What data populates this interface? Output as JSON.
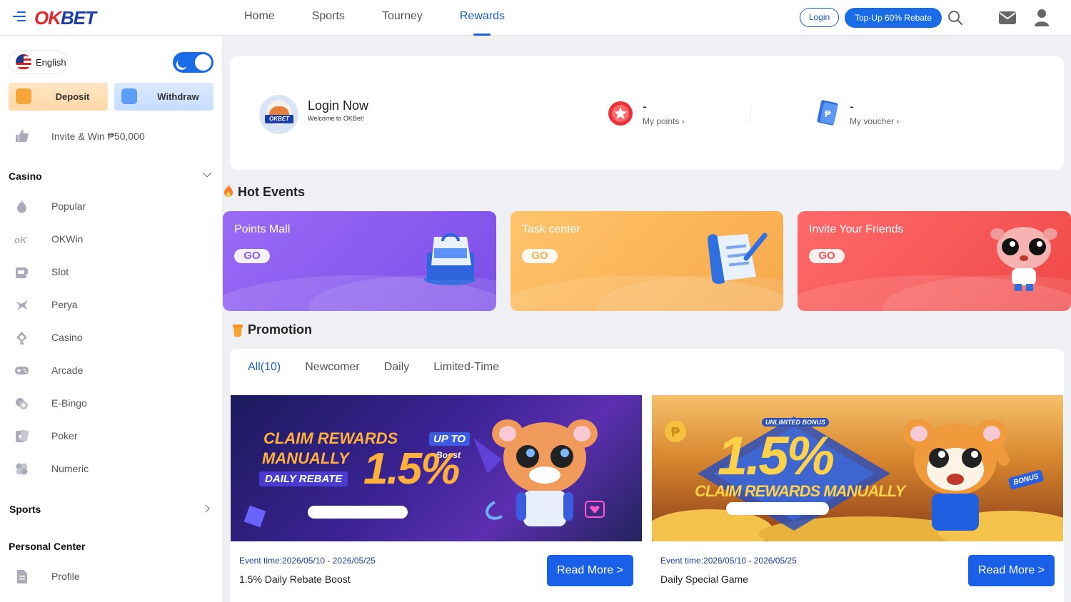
{
  "header": {
    "logo": {
      "ok": "OK",
      "bet": "BET"
    },
    "nav": [
      {
        "label": "Home",
        "active": false
      },
      {
        "label": "Sports",
        "active": false
      },
      {
        "label": "Tourney",
        "active": false
      },
      {
        "label": "Rewards",
        "active": true
      }
    ],
    "login_label": "Login",
    "topup_label": "Top-Up 60% Rebate",
    "icons": [
      "menu-icon",
      "search-icon",
      "mail-icon",
      "user-icon"
    ]
  },
  "sidebar": {
    "language": "English",
    "theme": "dark-mode-toggle-on",
    "deposit_label": "Deposit",
    "withdraw_label": "Withdraw",
    "invite_label": "Invite & Win ₱50,000",
    "casino_title": "Casino",
    "casino_items": [
      {
        "label": "Popular",
        "icon": "flame-icon"
      },
      {
        "label": "OKWin",
        "icon": "okwin-icon"
      },
      {
        "label": "Slot",
        "icon": "slot-icon"
      },
      {
        "label": "Perya",
        "icon": "perya-icon"
      },
      {
        "label": "Casino",
        "icon": "spade-icon"
      },
      {
        "label": "Arcade",
        "icon": "gamepad-icon"
      },
      {
        "label": "E-Bingo",
        "icon": "bingo-icon"
      },
      {
        "label": "Poker",
        "icon": "poker-icon"
      },
      {
        "label": "Numeric",
        "icon": "numeric-icon"
      }
    ],
    "sports_title": "Sports",
    "personal_title": "Personal Center",
    "personal_items": [
      {
        "label": "Profile",
        "icon": "document-icon"
      }
    ]
  },
  "login_card": {
    "title": "Login Now",
    "subtitle": "Welcome to OKBet!",
    "avatar_badge": "OKBET",
    "points_value": "-",
    "points_label": "My points ›",
    "voucher_value": "-",
    "voucher_label": "My voucher ›"
  },
  "hot_events": {
    "title": "Hot Events",
    "cards": [
      {
        "title": "Points Mall",
        "go": "GO",
        "color": "#8a5cf0"
      },
      {
        "title": "Task center",
        "go": "GO",
        "color": "#f6b25a"
      },
      {
        "title": "Invite Your Friends",
        "go": "GO",
        "color": "#f25555"
      }
    ]
  },
  "promotion": {
    "title": "Promotion",
    "tabs": [
      {
        "label": "All(10)",
        "active": true
      },
      {
        "label": "Newcomer",
        "active": false
      },
      {
        "label": "Daily",
        "active": false
      },
      {
        "label": "Limited-Time",
        "active": false
      }
    ],
    "items": [
      {
        "banner_line1": "CLAIM REWARDS",
        "banner_line2": "MANUALLY",
        "banner_line3": "DAILY REBATE",
        "banner_up_to": "UP TO",
        "banner_boost": "Boost",
        "banner_big": "1.5%",
        "event_time": "Event time:2026/05/10 - 2026/05/25",
        "name": "1.5% Daily Rebate Boost",
        "button": "Read More >"
      },
      {
        "banner_top": "UNLIMITED BONUS",
        "banner_big": "1.5%",
        "banner_claim": "CLAIM REWARDS MANUALLY",
        "banner_bonus": "BONUS",
        "event_time": "Event time:2026/05/10 - 2026/05/25",
        "name": "Daily Special Game",
        "button": "Read More >"
      }
    ]
  },
  "colors": {
    "accent": "#1a5fd8",
    "topup": "#1a6be8",
    "brand_red": "#e0262b",
    "brand_blue": "#1a3da8"
  }
}
